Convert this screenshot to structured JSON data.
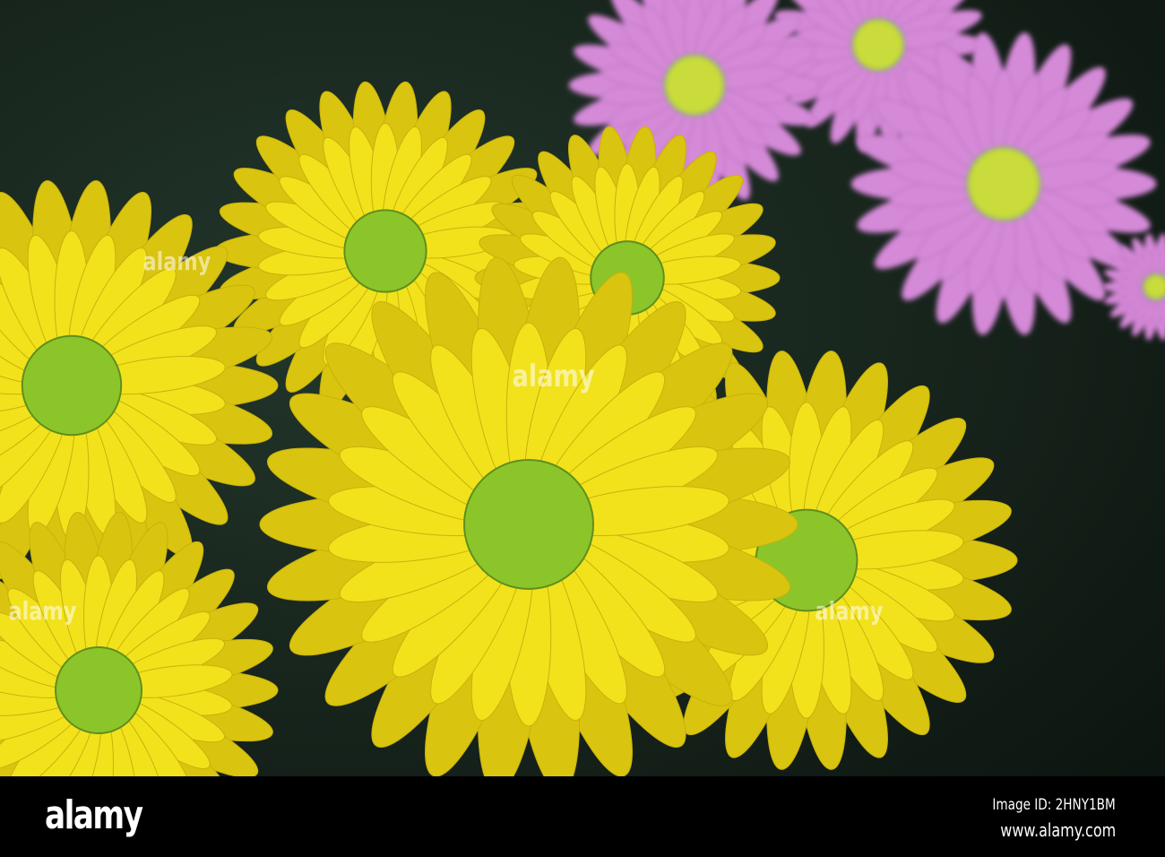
{
  "photo": {
    "subject": "yellow and pink chrysanthemum flowers",
    "colors": {
      "background": "#17241d",
      "yellow_petal": "#f2e21c",
      "yellow_shade": "#d9c40f",
      "center_green": "#8cc52a",
      "pink_petal": "#d58ad8",
      "pink_center": "#c9dc3a"
    }
  },
  "watermark": {
    "text": "alamy"
  },
  "footer": {
    "logo": "alamy",
    "image_id": "Image ID: 2HNY1BM",
    "website": "www.alamy.com"
  }
}
